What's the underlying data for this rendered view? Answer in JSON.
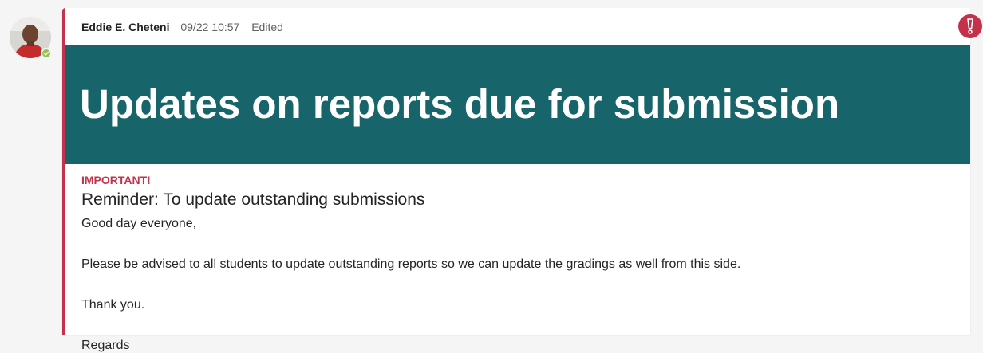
{
  "message": {
    "author": "Eddie E. Cheteni",
    "timestamp": "09/22 10:57",
    "edited_label": "Edited",
    "banner_title": "Updates on reports due for submission",
    "importance_label": "IMPORTANT!",
    "subject": "Reminder: To update outstanding submissions",
    "body": [
      "Good day everyone,",
      "Please be advised to all students to update outstanding reports so we can update the gradings as well from this side.",
      "Thank you.",
      "Regards"
    ]
  },
  "icons": {
    "presence": "available-check-icon",
    "importance": "exclamation-icon"
  },
  "colors": {
    "accent_important": "#c4314b",
    "banner_background": "#17656a",
    "presence_available": "#92c353"
  }
}
